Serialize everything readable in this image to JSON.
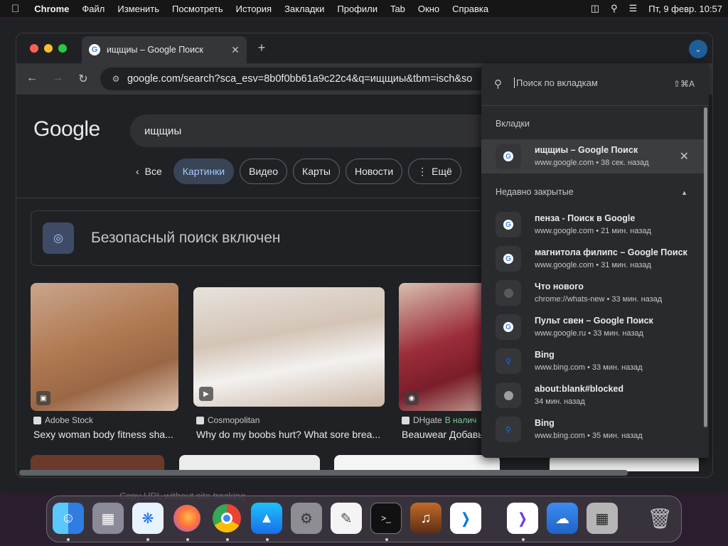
{
  "menubar": {
    "app": "Chrome",
    "items": [
      "Файл",
      "Изменить",
      "Посмотреть",
      "История",
      "Закладки",
      "Профили",
      "Tab",
      "Окно",
      "Справка"
    ],
    "datetime": "Пт, 9 февр.  10:57"
  },
  "background_window": {
    "faint_text": "Copy URL without site tracking"
  },
  "browser": {
    "tab": {
      "title": "ищщиы – Google Поиск",
      "favicon": "G"
    },
    "new_tab": "+",
    "omnibox": {
      "url": "google.com/search?sca_esv=8b0f0bb61a9c22c4&q=ищщиы&tbm=isch&so"
    }
  },
  "google": {
    "logo": "Google",
    "query": "ищщиы",
    "chips": [
      {
        "label": "Все"
      },
      {
        "label": "Картинки"
      },
      {
        "label": "Видео"
      },
      {
        "label": "Карты"
      },
      {
        "label": "Новости"
      },
      {
        "label": "Ещё"
      }
    ],
    "safe_search": "Безопасный поиск включен",
    "results": [
      {
        "source": "Adobe Stock",
        "caption": "Sexy woman body fitness sha..."
      },
      {
        "source": "Cosmopolitan",
        "caption": "Why do my boobs hurt? What sore brea..."
      },
      {
        "source": "DHgate",
        "source_extra": "В налич",
        "caption": "Beauwear Добавь"
      }
    ]
  },
  "tab_search": {
    "placeholder": "Поиск по вкладкам",
    "shortcut": "⇧⌘A",
    "open_header": "Вкладки",
    "open_tabs": [
      {
        "title": "ищщиы – Google Поиск",
        "subtitle": "www.google.com • 38 сек. назад"
      }
    ],
    "closed_header": "Недавно закрытые",
    "closed_tabs": [
      {
        "title": "пенза - Поиск в Google",
        "subtitle": "www.google.com • 21 мин. назад",
        "icon": "google"
      },
      {
        "title": "магнитола филипс – Google Поиск",
        "subtitle": "www.google.com • 31 мин. назад",
        "icon": "google"
      },
      {
        "title": "Что нового",
        "subtitle": "chrome://whats-new • 33 мин. назад",
        "icon": "chrome"
      },
      {
        "title": "Пульт свен – Google Поиск",
        "subtitle": "www.google.ru • 33 мин. назад",
        "icon": "google"
      },
      {
        "title": "Bing",
        "subtitle": "www.bing.com • 33 мин. назад",
        "icon": "bing"
      },
      {
        "title": "about:blank#blocked",
        "subtitle": "34 мин. назад",
        "icon": "globe"
      },
      {
        "title": "Bing",
        "subtitle": "www.bing.com • 35 мин. назад",
        "icon": "bing"
      }
    ]
  },
  "dock": {
    "apps": [
      "Finder",
      "Launchpad",
      "Safari",
      "Firefox",
      "Chrome",
      "App Store",
      "System Settings",
      "TextEdit",
      "Terminal",
      "GarageBand",
      "VS Code",
      "Visual Studio",
      "Weather",
      "Calculator",
      "Trash"
    ]
  }
}
